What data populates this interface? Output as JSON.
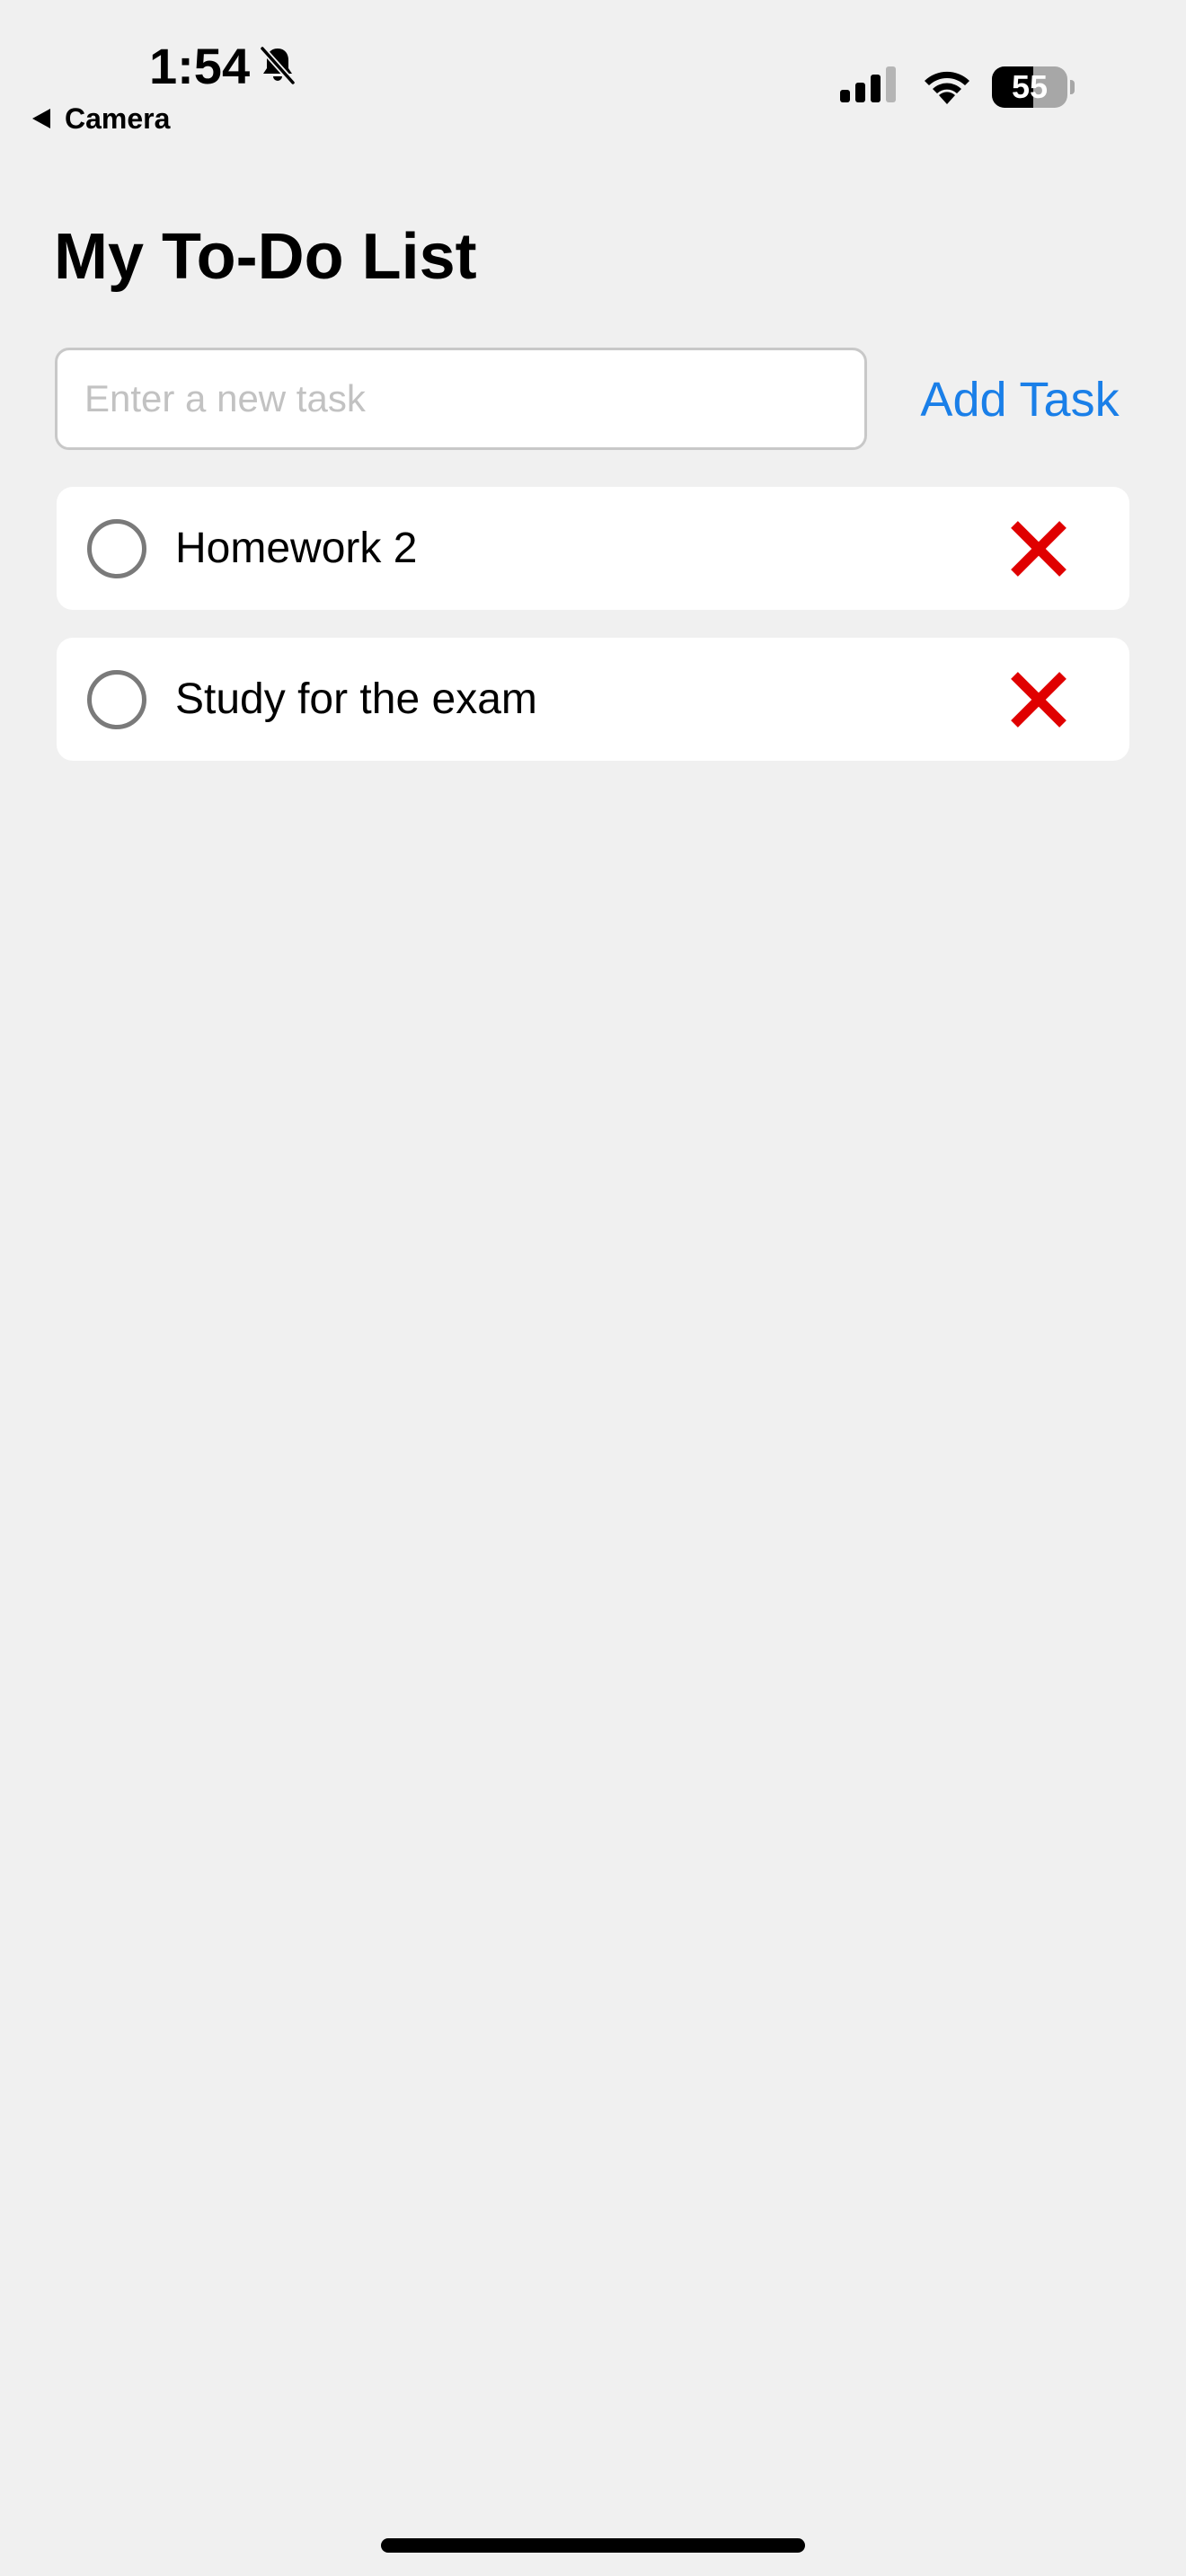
{
  "status_bar": {
    "time": "1:54",
    "back_label": "Camera",
    "battery_percent": "55",
    "battery_level": 0.55,
    "icons": [
      "bell-slash-icon",
      "cellular-signal-icon",
      "wifi-icon",
      "battery-icon"
    ]
  },
  "page": {
    "title": "My To-Do List"
  },
  "new_task": {
    "placeholder": "Enter a new task",
    "value": "",
    "add_label": "Add Task"
  },
  "tasks": [
    {
      "text": "Homework 2",
      "completed": false
    },
    {
      "text": "Study for the exam",
      "completed": false
    }
  ],
  "colors": {
    "background": "#f0f0f0",
    "accent": "#1a7fe8",
    "delete": "#e00000",
    "checkbox_border": "#7a7a7a"
  }
}
